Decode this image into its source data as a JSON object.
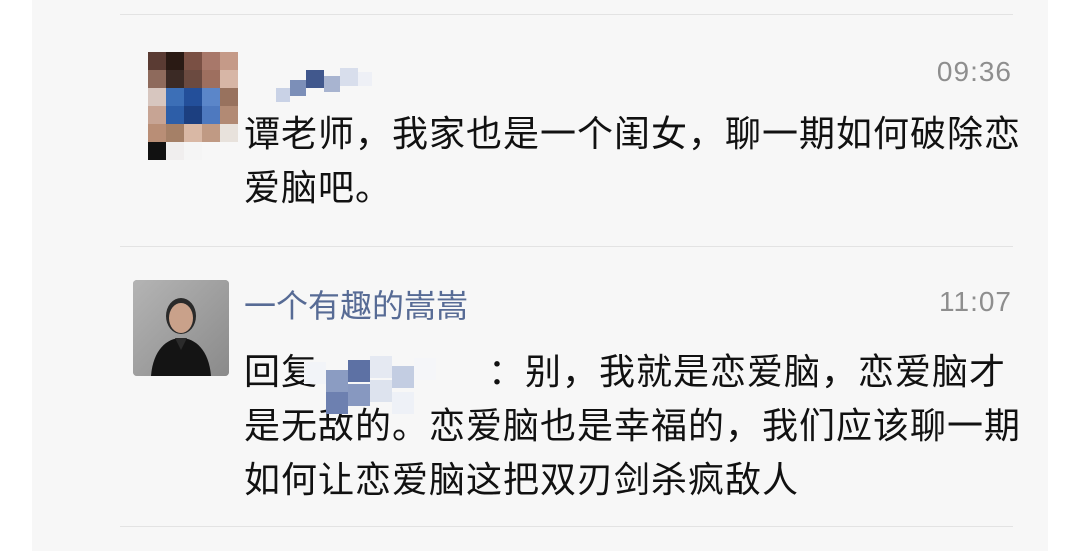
{
  "comments": [
    {
      "name": "",
      "time": "09:36",
      "text": "谭老师，我家也是一个闺女，聊一期如何破除恋爱脑吧。",
      "avatar_colors": {
        "top_row": [
          "#5a3b33",
          "#2a1a14",
          "#7a5044",
          "#a8786a"
        ],
        "mid_row": [
          "#3c6fb7",
          "#234f9a",
          "#5b86c9",
          "#98725e"
        ],
        "bottom_row": [
          "#b98e76",
          "#a58067",
          "#111111",
          "#e8e2dc"
        ]
      }
    },
    {
      "name": "一个有趣的嵩嵩",
      "time": "11:07",
      "reply_prefix": "回复",
      "text": "：别，我就是恋爱脑，恋爱脑才是无敌的。恋爱脑也是幸福的，我们应该聊一期如何让恋爱脑这把双刃剑杀疯敌人"
    }
  ],
  "colors": {
    "name_blue": "#576b95",
    "time_gray": "#8e8e8e",
    "panel_bg": "#f7f7f7",
    "divider": "#e3e3e3"
  }
}
